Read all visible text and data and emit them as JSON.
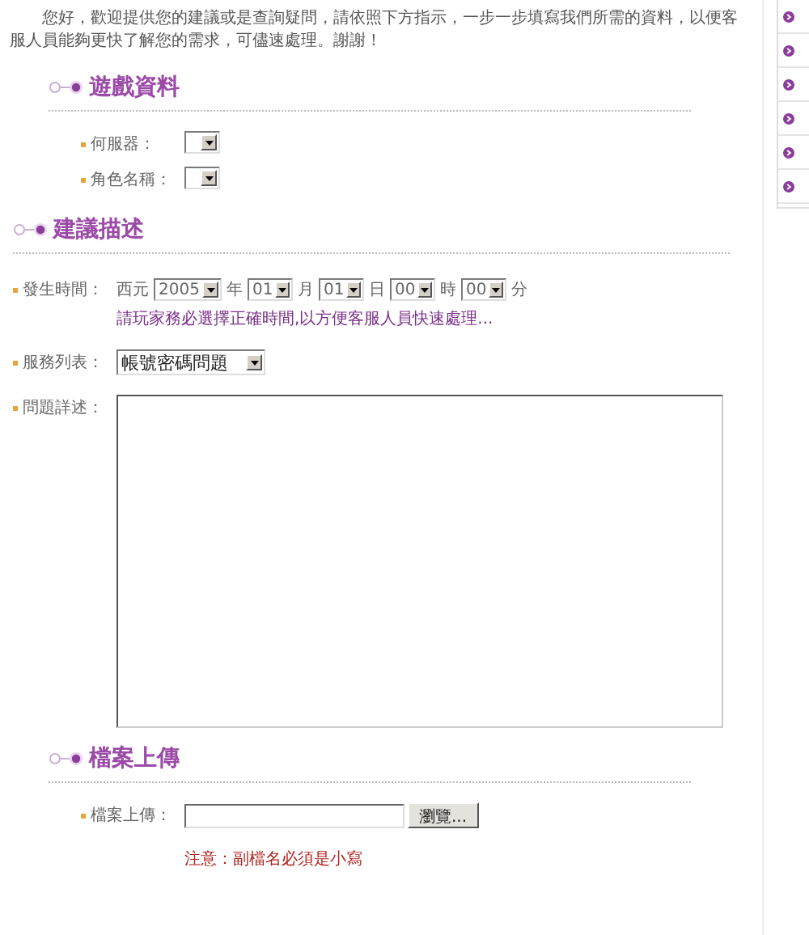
{
  "intro": "您好，歡迎提供您的建議或是查詢疑問，請依照下方指示，一步一步填寫我們所需的資料，以便客服人員能夠更快了解您的需求，可儘速處理。謝謝！",
  "sections": [
    {
      "title": "遊戲資料",
      "indented": true,
      "rows": [
        {
          "kind": "select",
          "label": "何服器："
        },
        {
          "kind": "select",
          "label": "角色名稱："
        }
      ]
    },
    {
      "title": "建議描述",
      "indented": false,
      "rows": [
        {
          "kind": "datetime",
          "label": "發生時間：",
          "prefix": "西元",
          "parts": [
            {
              "value": "2005",
              "unit": "年"
            },
            {
              "value": "01",
              "unit": "月"
            },
            {
              "value": "01",
              "unit": "日"
            },
            {
              "value": "00",
              "unit": "時"
            },
            {
              "value": "00",
              "unit": "分"
            }
          ],
          "hint": "請玩家務必選擇正確時間,以方便客服人員快速處理..."
        },
        {
          "kind": "select",
          "label": "服務列表：",
          "value": "帳號密碼問題",
          "wide": true
        },
        {
          "kind": "textarea",
          "label": "問題詳述："
        }
      ]
    },
    {
      "title": "檔案上傳",
      "indented": true,
      "rows": [
        {
          "kind": "file",
          "label": "檔案上傳：",
          "button": "瀏覽...",
          "note": "注意：副檔名必須是小寫"
        }
      ]
    }
  ]
}
